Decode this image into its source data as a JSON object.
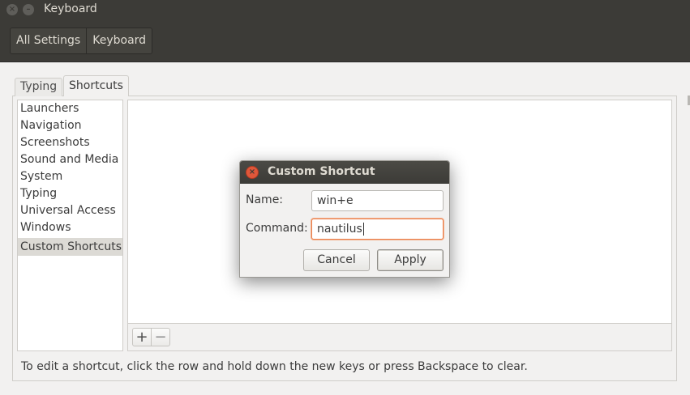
{
  "window": {
    "title": "Keyboard",
    "close_glyph": "×",
    "min_glyph": "–"
  },
  "breadcrumb": {
    "items": [
      "All Settings",
      "Keyboard"
    ]
  },
  "tabs": [
    {
      "label": "Typing",
      "active": false
    },
    {
      "label": "Shortcuts",
      "active": true
    }
  ],
  "categories": {
    "items": [
      "Launchers",
      "Navigation",
      "Screenshots",
      "Sound and Media",
      "System",
      "Typing",
      "Universal Access",
      "Windows",
      "Custom Shortcuts"
    ],
    "selected": "Custom Shortcuts"
  },
  "pane_toolbar": {
    "add_glyph": "+",
    "remove_glyph": "−"
  },
  "hint": "To edit a shortcut, click the row and hold down the new keys or press Backspace to clear.",
  "dialog": {
    "title": "Custom Shortcut",
    "close_glyph": "×",
    "name_label": "Name:",
    "name_value": "win+e",
    "command_label": "Command:",
    "command_value": "nautilus",
    "cancel_label": "Cancel",
    "apply_label": "Apply"
  },
  "colors": {
    "titlebar": "#3c3b37",
    "accent_focus": "#e9804c",
    "close_button": "#e0573a"
  }
}
